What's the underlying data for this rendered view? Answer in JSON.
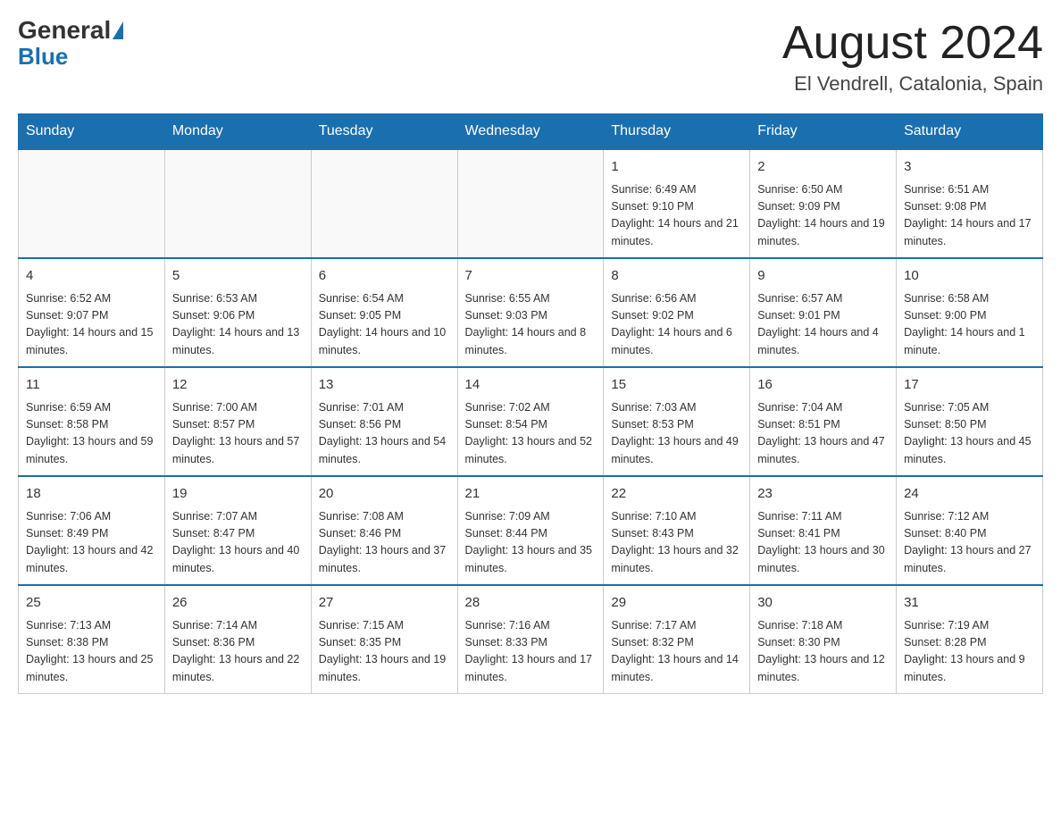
{
  "header": {
    "logo_general": "General",
    "logo_blue": "Blue",
    "month_title": "August 2024",
    "location": "El Vendrell, Catalonia, Spain"
  },
  "weekdays": [
    "Sunday",
    "Monday",
    "Tuesday",
    "Wednesday",
    "Thursday",
    "Friday",
    "Saturday"
  ],
  "weeks": [
    [
      {
        "day": "",
        "info": ""
      },
      {
        "day": "",
        "info": ""
      },
      {
        "day": "",
        "info": ""
      },
      {
        "day": "",
        "info": ""
      },
      {
        "day": "1",
        "info": "Sunrise: 6:49 AM\nSunset: 9:10 PM\nDaylight: 14 hours and 21 minutes."
      },
      {
        "day": "2",
        "info": "Sunrise: 6:50 AM\nSunset: 9:09 PM\nDaylight: 14 hours and 19 minutes."
      },
      {
        "day": "3",
        "info": "Sunrise: 6:51 AM\nSunset: 9:08 PM\nDaylight: 14 hours and 17 minutes."
      }
    ],
    [
      {
        "day": "4",
        "info": "Sunrise: 6:52 AM\nSunset: 9:07 PM\nDaylight: 14 hours and 15 minutes."
      },
      {
        "day": "5",
        "info": "Sunrise: 6:53 AM\nSunset: 9:06 PM\nDaylight: 14 hours and 13 minutes."
      },
      {
        "day": "6",
        "info": "Sunrise: 6:54 AM\nSunset: 9:05 PM\nDaylight: 14 hours and 10 minutes."
      },
      {
        "day": "7",
        "info": "Sunrise: 6:55 AM\nSunset: 9:03 PM\nDaylight: 14 hours and 8 minutes."
      },
      {
        "day": "8",
        "info": "Sunrise: 6:56 AM\nSunset: 9:02 PM\nDaylight: 14 hours and 6 minutes."
      },
      {
        "day": "9",
        "info": "Sunrise: 6:57 AM\nSunset: 9:01 PM\nDaylight: 14 hours and 4 minutes."
      },
      {
        "day": "10",
        "info": "Sunrise: 6:58 AM\nSunset: 9:00 PM\nDaylight: 14 hours and 1 minute."
      }
    ],
    [
      {
        "day": "11",
        "info": "Sunrise: 6:59 AM\nSunset: 8:58 PM\nDaylight: 13 hours and 59 minutes."
      },
      {
        "day": "12",
        "info": "Sunrise: 7:00 AM\nSunset: 8:57 PM\nDaylight: 13 hours and 57 minutes."
      },
      {
        "day": "13",
        "info": "Sunrise: 7:01 AM\nSunset: 8:56 PM\nDaylight: 13 hours and 54 minutes."
      },
      {
        "day": "14",
        "info": "Sunrise: 7:02 AM\nSunset: 8:54 PM\nDaylight: 13 hours and 52 minutes."
      },
      {
        "day": "15",
        "info": "Sunrise: 7:03 AM\nSunset: 8:53 PM\nDaylight: 13 hours and 49 minutes."
      },
      {
        "day": "16",
        "info": "Sunrise: 7:04 AM\nSunset: 8:51 PM\nDaylight: 13 hours and 47 minutes."
      },
      {
        "day": "17",
        "info": "Sunrise: 7:05 AM\nSunset: 8:50 PM\nDaylight: 13 hours and 45 minutes."
      }
    ],
    [
      {
        "day": "18",
        "info": "Sunrise: 7:06 AM\nSunset: 8:49 PM\nDaylight: 13 hours and 42 minutes."
      },
      {
        "day": "19",
        "info": "Sunrise: 7:07 AM\nSunset: 8:47 PM\nDaylight: 13 hours and 40 minutes."
      },
      {
        "day": "20",
        "info": "Sunrise: 7:08 AM\nSunset: 8:46 PM\nDaylight: 13 hours and 37 minutes."
      },
      {
        "day": "21",
        "info": "Sunrise: 7:09 AM\nSunset: 8:44 PM\nDaylight: 13 hours and 35 minutes."
      },
      {
        "day": "22",
        "info": "Sunrise: 7:10 AM\nSunset: 8:43 PM\nDaylight: 13 hours and 32 minutes."
      },
      {
        "day": "23",
        "info": "Sunrise: 7:11 AM\nSunset: 8:41 PM\nDaylight: 13 hours and 30 minutes."
      },
      {
        "day": "24",
        "info": "Sunrise: 7:12 AM\nSunset: 8:40 PM\nDaylight: 13 hours and 27 minutes."
      }
    ],
    [
      {
        "day": "25",
        "info": "Sunrise: 7:13 AM\nSunset: 8:38 PM\nDaylight: 13 hours and 25 minutes."
      },
      {
        "day": "26",
        "info": "Sunrise: 7:14 AM\nSunset: 8:36 PM\nDaylight: 13 hours and 22 minutes."
      },
      {
        "day": "27",
        "info": "Sunrise: 7:15 AM\nSunset: 8:35 PM\nDaylight: 13 hours and 19 minutes."
      },
      {
        "day": "28",
        "info": "Sunrise: 7:16 AM\nSunset: 8:33 PM\nDaylight: 13 hours and 17 minutes."
      },
      {
        "day": "29",
        "info": "Sunrise: 7:17 AM\nSunset: 8:32 PM\nDaylight: 13 hours and 14 minutes."
      },
      {
        "day": "30",
        "info": "Sunrise: 7:18 AM\nSunset: 8:30 PM\nDaylight: 13 hours and 12 minutes."
      },
      {
        "day": "31",
        "info": "Sunrise: 7:19 AM\nSunset: 8:28 PM\nDaylight: 13 hours and 9 minutes."
      }
    ]
  ]
}
